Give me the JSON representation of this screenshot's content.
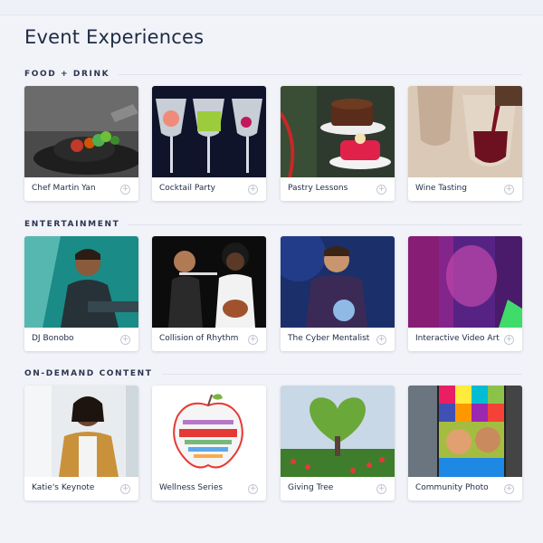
{
  "page": {
    "title": "Event Experiences"
  },
  "sections": [
    {
      "title": "Food + Drink",
      "items": [
        {
          "label": "Chef Martin Yan"
        },
        {
          "label": "Cocktail Party"
        },
        {
          "label": "Pastry Lessons"
        },
        {
          "label": "Wine Tasting"
        }
      ]
    },
    {
      "title": "Entertainment",
      "items": [
        {
          "label": "DJ Bonobo"
        },
        {
          "label": "Collision of Rhythm"
        },
        {
          "label": "The Cyber Mentalist"
        },
        {
          "label": "Interactive Video Art"
        }
      ]
    },
    {
      "title": "On-Demand Content",
      "items": [
        {
          "label": "Katie's Keynote"
        },
        {
          "label": "Wellness Series"
        },
        {
          "label": "Giving Tree"
        },
        {
          "label": "Community Photo"
        }
      ]
    }
  ],
  "icons": {
    "card_action": "plus-circle-icon"
  },
  "colors": {
    "background": "#f1f3f8",
    "text": "#1f2a44",
    "icon": "#b6bcc7"
  }
}
